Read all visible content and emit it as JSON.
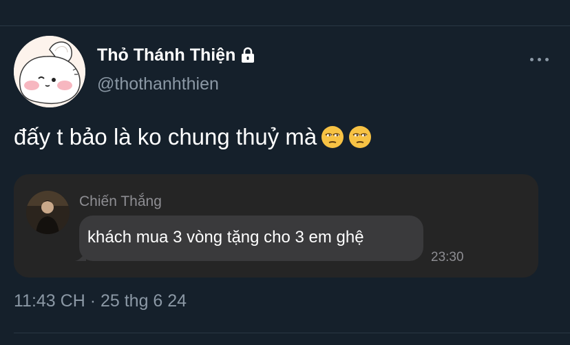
{
  "tweet": {
    "author": {
      "display_name": "Thỏ Thánh Thiện",
      "handle": "@thothanhthien",
      "protected_icon": "lock-icon",
      "avatar": "bunny-avatar"
    },
    "more_icon": "more-horizontal-icon",
    "text": "đấy t bảo là ko chung thuỷ mà",
    "emojis": [
      "unamused-face",
      "unamused-face"
    ],
    "timestamp": "11:43 CH · 25 thg 6 24"
  },
  "quoted_message": {
    "sender_name": "Chiến Thắng",
    "message": "khách mua 3 vòng tặng cho 3 em ghệ",
    "time": "23:30",
    "sender_avatar": "person-photo-avatar"
  },
  "colors": {
    "background": "#15202b",
    "secondary_text": "#8b98a5",
    "card_background": "#252525",
    "bubble_background": "#3a3a3c"
  }
}
